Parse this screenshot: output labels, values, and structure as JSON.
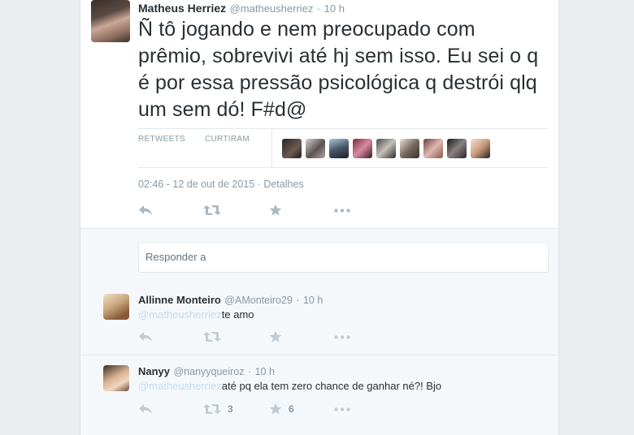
{
  "tweet": {
    "name": "Matheus Herriez",
    "handle": "@matheusherriez",
    "sep": "·",
    "time": "10 h",
    "text": "Ñ tô jogando e nem preocupado com prêmio, sobrevivi até hj sem isso. Eu sei o q é por essa pressão psicológica q destrói qlq um sem dó! F#d@",
    "retweets_label": "RETWEETS",
    "likes_label": "CURTIRAM",
    "timestamp": "02:46 - 12 de out de 2015",
    "details_link": "Detalhes"
  },
  "reply_composer": {
    "placeholder": "Responder a"
  },
  "replies": [
    {
      "name": "Allinne Monteiro",
      "handle": "@AMonteiro29",
      "sep": "·",
      "time": "10 h",
      "mention": "@matheusherriez",
      "text": "te amo",
      "retweet_count": "",
      "like_count": ""
    },
    {
      "name": "Nanyy",
      "handle": "@nanyyqueiroz",
      "sep": "·",
      "time": "10 h",
      "mention": "@matheusherriez",
      "text": "até pq ela tem zero chance de ganhar né?! Bjo",
      "retweet_count": "3",
      "like_count": "6"
    }
  ],
  "icons": {
    "reply": "reply-icon",
    "retweet": "retweet-icon",
    "like": "star-icon",
    "more": "more-icon"
  },
  "colors": {
    "text": "#292f33",
    "muted": "#8899a6",
    "action_icon": "#aab8c2",
    "reply_bg": "#f5f8fa",
    "page_bg": "#e9edf0"
  }
}
